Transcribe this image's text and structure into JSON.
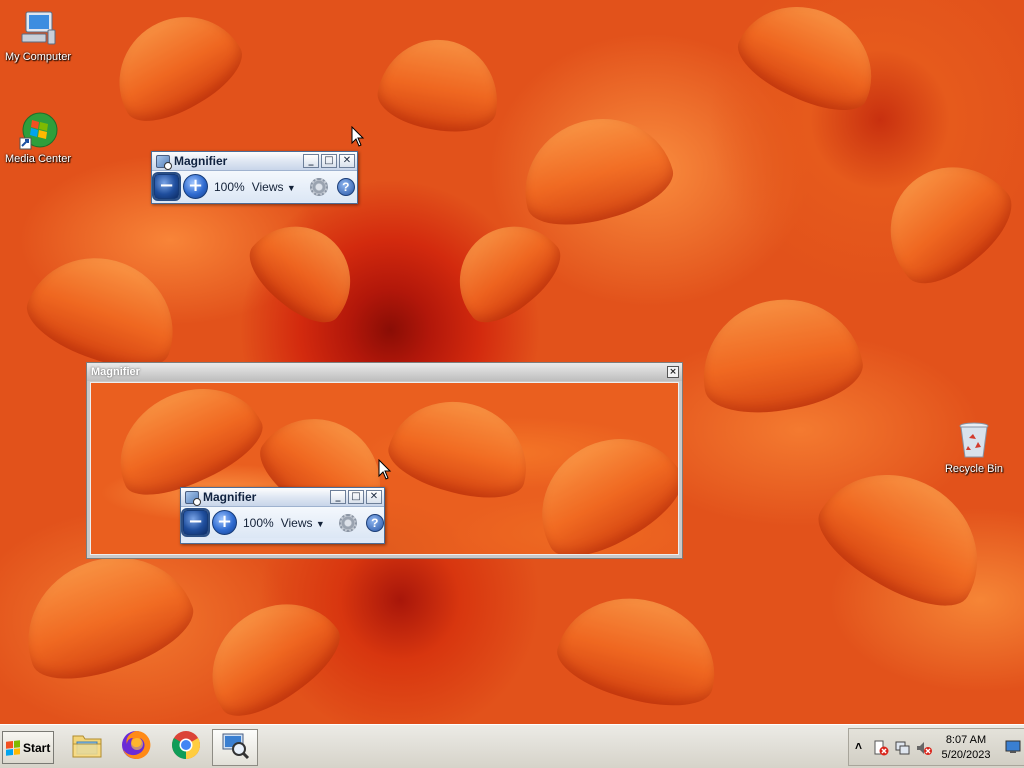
{
  "desktop": {
    "icons": [
      {
        "label": "My Computer",
        "icon": "computer-icon"
      },
      {
        "label": "Media Center",
        "icon": "media-center-icon"
      },
      {
        "label": "Recycle Bin",
        "icon": "recycle-bin-icon"
      }
    ]
  },
  "magnifier_toolbar": {
    "title": "Magnifier",
    "zoom_level": "100%",
    "views_label": "Views",
    "minimize_glyph": "_",
    "maximize_glyph": "□",
    "close_glyph": "✕",
    "zoom_out_glyph": "−",
    "zoom_in_glyph": "+",
    "help_glyph": "?"
  },
  "magnifier_lens": {
    "title": "Magnifier",
    "close_glyph": "×",
    "mirrored_toolbar": {
      "title": "Magnifier",
      "zoom_level": "100%",
      "views_label": "Views"
    }
  },
  "taskbar": {
    "start_label": "Start",
    "apps": [
      {
        "name": "file-explorer",
        "icon": "folder-icon"
      },
      {
        "name": "firefox",
        "icon": "firefox-icon"
      },
      {
        "name": "chrome",
        "icon": "chrome-icon"
      },
      {
        "name": "magnifier",
        "icon": "magnifier-icon",
        "active": true
      }
    ],
    "tray": {
      "expand_glyph": "˄",
      "time": "8:07 AM",
      "date": "5/20/2023"
    }
  },
  "colors": {
    "wallpaper_base": "#e2521b",
    "taskbar": "#d6d3c9",
    "window_frame": "#4d6d97"
  }
}
